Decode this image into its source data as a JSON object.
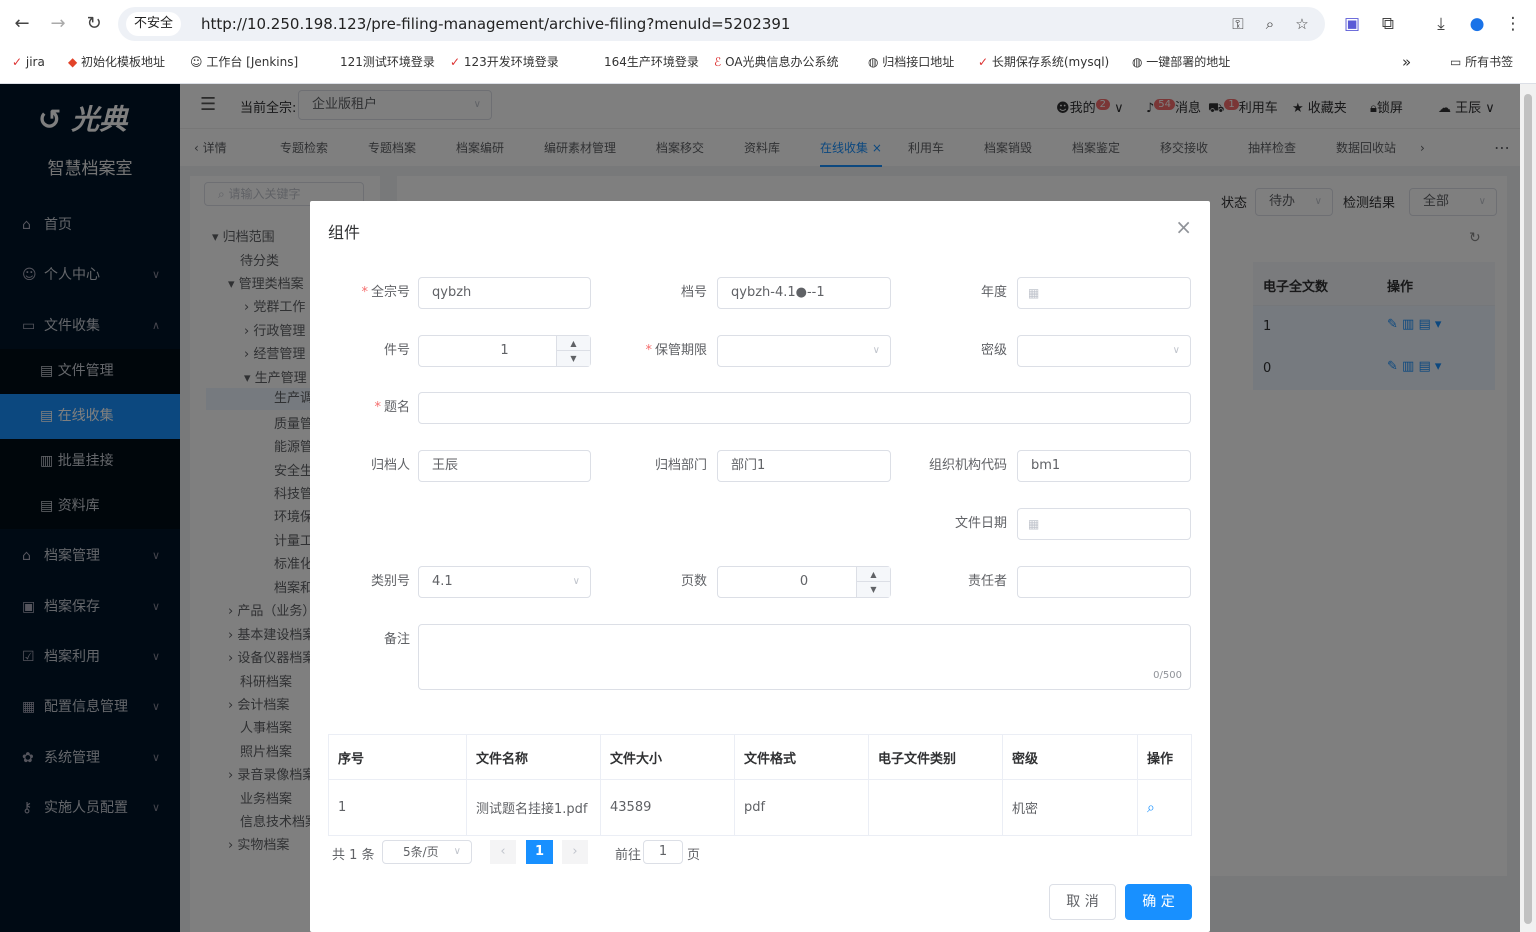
{
  "browser": {
    "security": "不安全",
    "url": "http://10.250.198.123/pre-filing-management/archive-filing?menuId=5202391"
  },
  "bookmarks": [
    "jira",
    "初始化模板地址",
    "工作台 [Jenkins]",
    "121测试环境登录",
    "123开发环境登录",
    "164生产环境登录",
    "OA光典信息办公系统",
    "归档接口地址",
    "长期保存系统(mysql)",
    "一键部署的地址",
    "所有书签"
  ],
  "sidebar": {
    "brand": "光典",
    "subtitle": "智慧档案室",
    "items": [
      {
        "label": "首页",
        "icon": "home-icon"
      },
      {
        "label": "个人中心",
        "icon": "user-icon"
      },
      {
        "label": "文件收集",
        "icon": "folder-icon"
      },
      {
        "label": "档案管理",
        "icon": "bank-icon"
      },
      {
        "label": "档案保存",
        "icon": "save-icon"
      },
      {
        "label": "档案利用",
        "icon": "check-icon"
      },
      {
        "label": "配置信息管理",
        "icon": "clipboard-icon"
      },
      {
        "label": "系统管理",
        "icon": "gear-icon"
      },
      {
        "label": "实施人员配置",
        "icon": "key-icon"
      }
    ],
    "subitems": [
      {
        "label": "文件管理"
      },
      {
        "label": "在线收集"
      },
      {
        "label": "批量挂接"
      },
      {
        "label": "资料库"
      }
    ]
  },
  "header": {
    "fonds_label": "当前全宗:",
    "fonds_value": "企业版租户",
    "mine": "我的",
    "mine_badge": "2",
    "msg": "消息",
    "msg_badge": "54",
    "cart": "利用车",
    "cart_badge": "1",
    "fav": "收藏夹",
    "lock": "锁屏",
    "user": "王辰"
  },
  "tabs": [
    "详情",
    "专题检索",
    "专题档案",
    "档案编研",
    "编研素材管理",
    "档案移交",
    "资料库",
    "在线收集",
    "利用车",
    "档案销毁",
    "档案鉴定",
    "移交接收",
    "抽样检查",
    "数据回收站"
  ],
  "tree": [
    "归档范围",
    "待分类",
    "管理类档案",
    "党群工作",
    "行政管理",
    "经营管理",
    "生产管理",
    "生产调",
    "质量管",
    "能源管",
    "安全生",
    "科技管",
    "环境保",
    "计量工",
    "标准化",
    "档案和",
    "产品（业务）",
    "基本建设档案",
    "设备仪器档案",
    "科研档案",
    "会计档案",
    "人事档案",
    "照片档案",
    "录音录像档案",
    "业务档案",
    "信息技术档案",
    "实物档案"
  ],
  "main": {
    "status_label": "状态",
    "status_value": "待办",
    "result_label": "检测结果",
    "result_value": "全部",
    "col_efiles": "电子全文数",
    "col_op": "操作",
    "rows": [
      "1",
      "0"
    ]
  },
  "dialog": {
    "title": "组件",
    "labels": {
      "fonds": "全宗号",
      "archno": "档号",
      "year": "年度",
      "itemno": "件号",
      "retention": "保管期限",
      "secret": "密级",
      "title": "题名",
      "archiver": "归档人",
      "dept": "归档部门",
      "orgcode": "组织机构代码",
      "filedate": "文件日期",
      "category": "类别号",
      "pages": "页数",
      "responsible": "责任者",
      "remark": "备注"
    },
    "values": {
      "fonds": "qybzh",
      "archno": "qybzh-4.1●--1",
      "year": "",
      "itemno": "1",
      "retention": "",
      "secret": "",
      "title": "",
      "archiver": "王辰",
      "dept": "部门1",
      "orgcode": "bm1",
      "filedate": "",
      "category": "4.1",
      "pages": "0",
      "responsible": "",
      "remark": ""
    },
    "remark_count": "0/500",
    "table": {
      "headers": [
        "序号",
        "文件名称",
        "文件大小",
        "文件格式",
        "电子文件类别",
        "密级",
        "操作"
      ],
      "rows": [
        [
          "1",
          "测试题名挂接1.pdf",
          "43589",
          "pdf",
          "",
          "机密",
          ""
        ]
      ]
    },
    "pager": {
      "total": "共 1 条",
      "size": "5条/页",
      "page": "1",
      "goto": "前往",
      "goto_value": "1",
      "unit": "页"
    },
    "cancel": "取 消",
    "ok": "确 定"
  }
}
